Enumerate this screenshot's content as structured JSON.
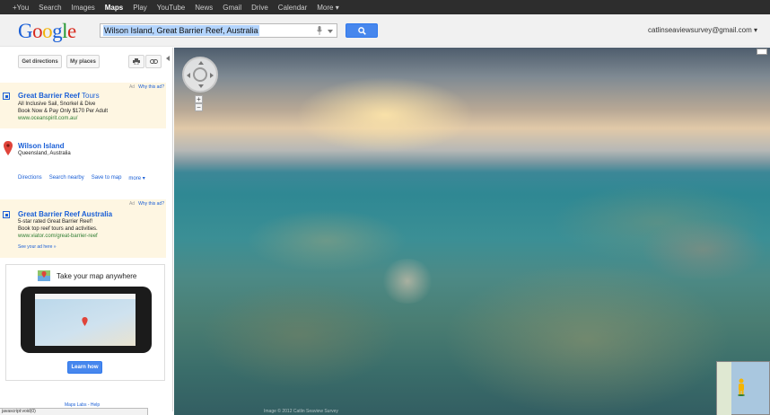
{
  "topbar": {
    "items": [
      "+You",
      "Search",
      "Images",
      "Maps",
      "Play",
      "YouTube",
      "News",
      "Gmail",
      "Drive",
      "Calendar",
      "More ▾"
    ],
    "active": "Maps"
  },
  "header": {
    "logo_letters": [
      "G",
      "o",
      "o",
      "g",
      "l",
      "e"
    ],
    "search_value": "Wilson Island, Great Barrier Reef, Australia",
    "account": "catlinseaviewsurvey@gmail.com ▾"
  },
  "panel": {
    "get_directions": "Get directions",
    "my_places": "My places",
    "ad1": {
      "label": "Ad",
      "why": "Why this ad?",
      "title_bold": "Great Barrier Reef",
      "title_rest": " Tours",
      "line1": "All Inclusive Sail, Snorkel & Dive",
      "line2": "Book Now & Pay Only $170 Per Adult",
      "url": "www.oceanspirit.com.au/"
    },
    "place": {
      "name": "Wilson Island",
      "sub": "Queensland, Australia",
      "actions": [
        "Directions",
        "Search nearby",
        "Save to map",
        "more ▾"
      ]
    },
    "ad2": {
      "label": "Ad",
      "why": "Why this ad?",
      "title": "Great Barrier Reef Australia",
      "line1": "5-star rated Great Barrier Reef!",
      "line2": "Book top reef tours and activities.",
      "url": "www.viator.com/great-barrier-reef",
      "see_ad": "See your ad here »"
    },
    "promo": {
      "title": "Take your map anywhere",
      "learn": "Learn how"
    },
    "footer": "Maps Labs - Help"
  },
  "streetview": {
    "copyright": "Image © 2012 Catlin Seaview Survey"
  },
  "status": "javascript:void(0)"
}
